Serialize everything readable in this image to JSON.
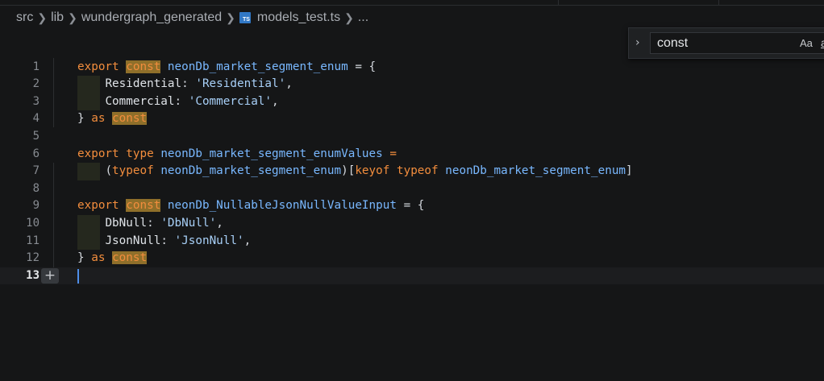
{
  "breadcrumb": {
    "items": [
      "src",
      "lib",
      "wundergraph_generated",
      "models_test.ts",
      "..."
    ],
    "file_icon": "TS"
  },
  "find": {
    "query": "const",
    "match_case_label": "Aa",
    "whole_word_label": "ab"
  },
  "editor": {
    "lines": [
      {
        "n": "1"
      },
      {
        "n": "2"
      },
      {
        "n": "3"
      },
      {
        "n": "4"
      },
      {
        "n": "5"
      },
      {
        "n": "6"
      },
      {
        "n": "7"
      },
      {
        "n": "8"
      },
      {
        "n": "9"
      },
      {
        "n": "10"
      },
      {
        "n": "11"
      },
      {
        "n": "12"
      },
      {
        "n": "13"
      }
    ],
    "tokens": {
      "export": "export",
      "const": "const",
      "type": "type",
      "as": "as",
      "typeof": "typeof",
      "keyof": "keyof",
      "enum_name": "neonDb_market_segment_enum",
      "enum_values_name": "neonDb_market_segment_enumValues",
      "nullable_name": "neonDb_NullableJsonNullValueInput",
      "residential_key": "Residential",
      "residential_val": "'Residential'",
      "commercial_key": "Commercial",
      "commercial_val": "'Commercial'",
      "dbnull_key": "DbNull",
      "dbnull_val": "'DbNull'",
      "jsonnull_key": "JsonNull",
      "jsonnull_val": "'JsonNull'"
    }
  }
}
